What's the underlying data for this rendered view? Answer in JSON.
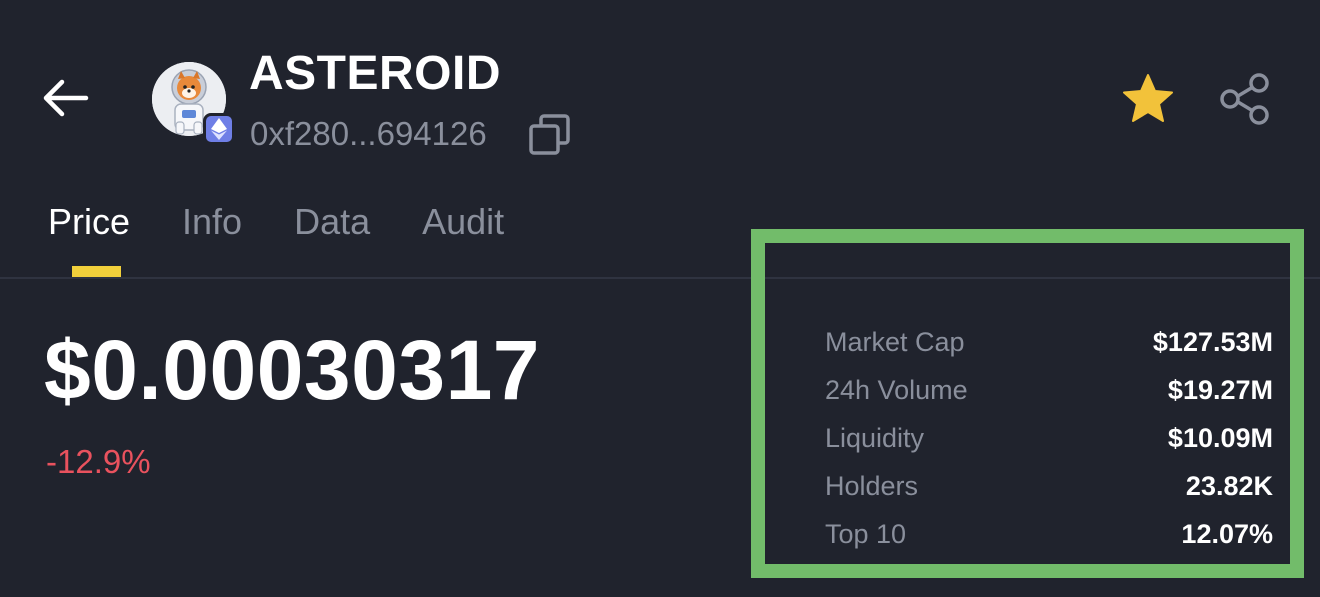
{
  "header": {
    "token_name": "ASTEROID",
    "token_address": "0xf280...694126",
    "back_icon": "arrow-left-icon",
    "copy_icon": "copy-icon",
    "favorite_icon": "star-icon",
    "share_icon": "share-icon",
    "chain_icon": "ethereum-icon"
  },
  "tabs": [
    {
      "label": "Price",
      "active": true
    },
    {
      "label": "Info",
      "active": false
    },
    {
      "label": "Data",
      "active": false
    },
    {
      "label": "Audit",
      "active": false
    }
  ],
  "price": {
    "value": "$0.00030317",
    "change": "-12.9%"
  },
  "stats": [
    {
      "label": "Market Cap",
      "value": "$127.53M"
    },
    {
      "label": "24h Volume",
      "value": "$19.27M"
    },
    {
      "label": "Liquidity",
      "value": "$10.09M"
    },
    {
      "label": "Holders",
      "value": "23.82K"
    },
    {
      "label": "Top 10",
      "value": "12.07%"
    }
  ],
  "colors": {
    "background": "#20232d",
    "accent_yellow": "#f2d03b",
    "negative": "#e9525e",
    "highlight_box": "#72bc6a",
    "muted_text": "#8a8f9c",
    "chain_badge": "#6f7fe6"
  }
}
